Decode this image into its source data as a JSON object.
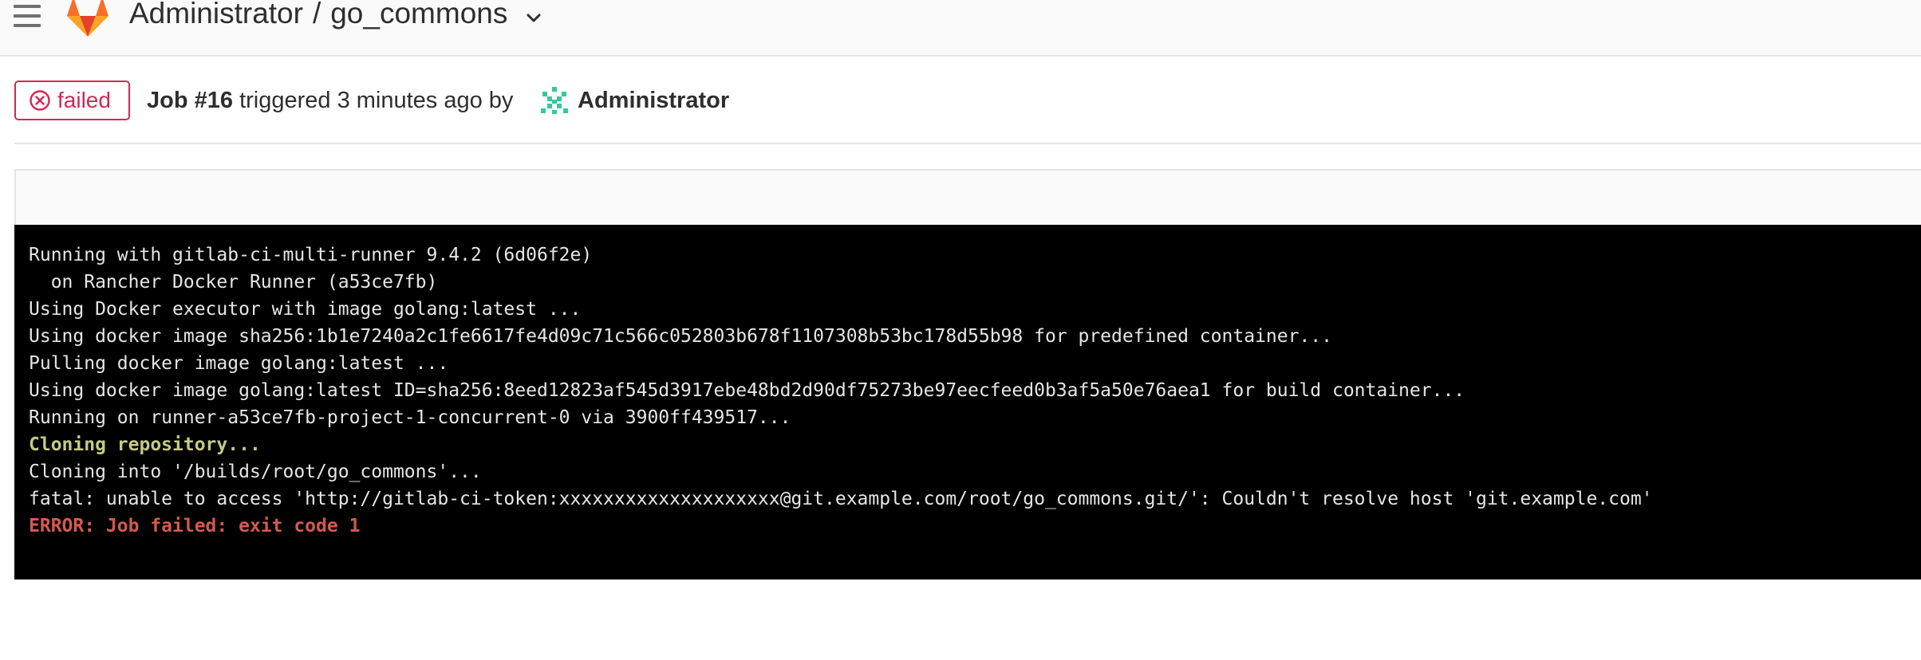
{
  "header": {
    "namespace": "Administrator",
    "separator": "/",
    "project": "go_commons",
    "menu_icon": "hamburger-icon",
    "logo_icon": "gitlab-fox-logo",
    "dropdown_icon": "chevron-down-icon"
  },
  "job": {
    "status": "failed",
    "status_icon": "x-circle-icon",
    "status_color": "#d22852",
    "id_label": "Job #16",
    "triggered_text": "triggered 3 minutes ago by",
    "user": "Administrator",
    "avatar_icon": "identicon-avatar"
  },
  "log": {
    "lines": [
      {
        "text": "Running with gitlab-ci-multi-runner 9.4.2 (6d06f2e)",
        "style": "normal"
      },
      {
        "text": "  on Rancher Docker Runner (a53ce7fb)",
        "style": "normal"
      },
      {
        "text": "Using Docker executor with image golang:latest ...",
        "style": "normal"
      },
      {
        "text": "Using docker image sha256:1b1e7240a2c1fe6617fe4d09c71c566c052803b678f1107308b53bc178d55b98 for predefined container...",
        "style": "normal"
      },
      {
        "text": "Pulling docker image golang:latest ...",
        "style": "normal"
      },
      {
        "text": "Using docker image golang:latest ID=sha256:8eed12823af545d3917ebe48bd2d90df75273be97eecfeed0b3af5a50e76aea1 for build container...",
        "style": "normal"
      },
      {
        "text": "Running on runner-a53ce7fb-project-1-concurrent-0 via 3900ff439517...",
        "style": "normal"
      },
      {
        "text": "Cloning repository...",
        "style": "green"
      },
      {
        "text": "Cloning into '/builds/root/go_commons'...",
        "style": "normal"
      },
      {
        "text": "fatal: unable to access 'http://gitlab-ci-token:xxxxxxxxxxxxxxxxxxxx@git.example.com/root/go_commons.git/': Couldn't resolve host 'git.example.com'",
        "style": "normal"
      },
      {
        "text": "ERROR: Job failed: exit code 1",
        "style": "red"
      }
    ],
    "colors": {
      "background": "#000000",
      "text": "#e6e6e6",
      "section": "#c5ca84",
      "error": "#d5594f"
    }
  }
}
